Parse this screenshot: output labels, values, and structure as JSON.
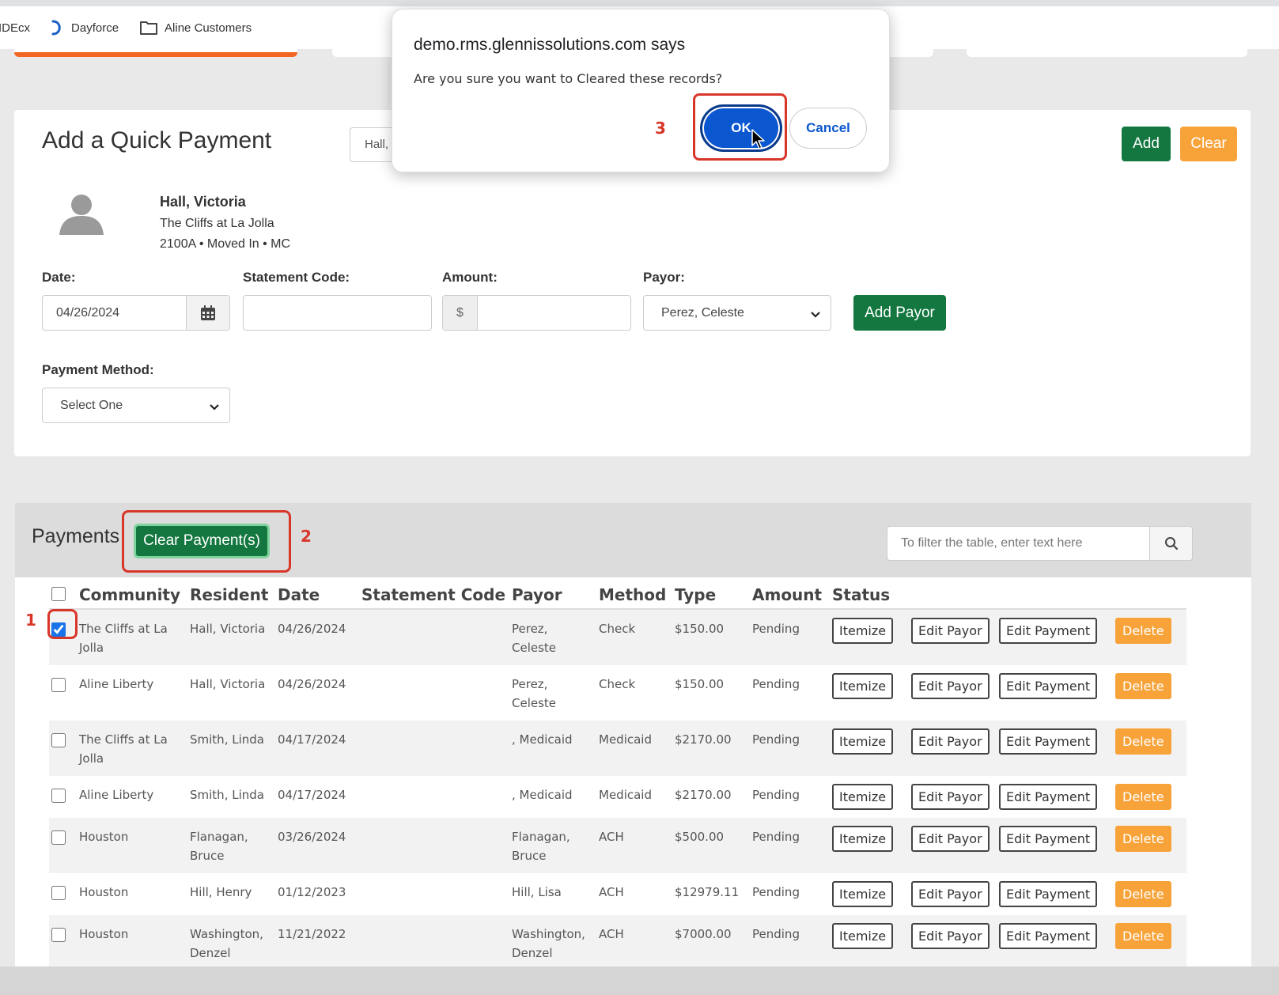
{
  "bookmarks": [
    {
      "label": "IDEcx",
      "icon": "idecx-icon"
    },
    {
      "label": "Dayforce",
      "icon": "dayforce-icon"
    },
    {
      "label": "Aline Customers",
      "icon": "folder-icon"
    }
  ],
  "dialog": {
    "title": "demo.rms.glennissolutions.com says",
    "message": "Are you sure you want to Cleared these records?",
    "ok_label": "OK",
    "cancel_label": "Cancel"
  },
  "quick_payment": {
    "title": "Add a Quick Payment",
    "resident_search_value": "Hall,",
    "add_label": "Add",
    "clear_label": "Clear",
    "resident": {
      "name": "Hall, Victoria",
      "community": "The Cliffs at La Jolla",
      "unit_status": "2100A • Moved In • MC"
    },
    "date_label": "Date:",
    "date_value": "04/26/2024",
    "statement_code_label": "Statement Code:",
    "statement_code_value": "",
    "amount_label": "Amount:",
    "amount_prefix": "$",
    "amount_value": "",
    "payor_label": "Payor:",
    "payor_value": "Perez, Celeste",
    "add_payor_label": "Add Payor",
    "payment_method_label": "Payment Method:",
    "payment_method_value": "Select One"
  },
  "payments": {
    "title": "Payments",
    "clear_payments_label": "Clear Payment(s)",
    "filter_placeholder": "To filter the table, enter text here",
    "columns": [
      "Community",
      "Resident",
      "Date",
      "Statement Code",
      "Payor",
      "Method",
      "Type",
      "Amount",
      "Status"
    ],
    "action_labels": {
      "itemize": "Itemize",
      "edit_payor": "Edit Payor",
      "edit_payment": "Edit Payment",
      "delete": "Delete"
    },
    "rows": [
      {
        "checked": true,
        "community": "The Cliffs at La Jolla",
        "resident": "Hall, Victoria",
        "date": "04/26/2024",
        "statement_code": "",
        "payor": "Perez, Celeste",
        "method": "Check",
        "amount": "$150.00",
        "status": "Pending"
      },
      {
        "checked": false,
        "community": "Aline Liberty",
        "resident": "Hall, Victoria",
        "date": "04/26/2024",
        "statement_code": "",
        "payor": "Perez, Celeste",
        "method": "Check",
        "amount": "$150.00",
        "status": "Pending"
      },
      {
        "checked": false,
        "community": "The Cliffs at La Jolla",
        "resident": "Smith, Linda",
        "date": "04/17/2024",
        "statement_code": "",
        "payor": ", Medicaid",
        "method": "Medicaid",
        "amount": "$2170.00",
        "status": "Pending"
      },
      {
        "checked": false,
        "community": "Aline Liberty",
        "resident": "Smith, Linda",
        "date": "04/17/2024",
        "statement_code": "",
        "payor": ", Medicaid",
        "method": "Medicaid",
        "amount": "$2170.00",
        "status": "Pending"
      },
      {
        "checked": false,
        "community": "Houston",
        "resident": "Flanagan, Bruce",
        "date": "03/26/2024",
        "statement_code": "",
        "payor": "Flanagan, Bruce",
        "method": "ACH",
        "amount": "$500.00",
        "status": "Pending"
      },
      {
        "checked": false,
        "community": "Houston",
        "resident": "Hill, Henry",
        "date": "01/12/2023",
        "statement_code": "",
        "payor": "Hill, Lisa",
        "method": "ACH",
        "amount": "$12979.11",
        "status": "Pending"
      },
      {
        "checked": false,
        "community": "Houston",
        "resident": "Washington, Denzel",
        "date": "11/21/2022",
        "statement_code": "",
        "payor": "Washington, Denzel",
        "method": "ACH",
        "amount": "$7000.00",
        "status": "Pending"
      }
    ]
  },
  "annotations": [
    "1",
    "2",
    "3"
  ],
  "colors": {
    "green": "#13773f",
    "orange": "#f7a33a",
    "dialog_blue": "#0b57d0",
    "annotation_red": "#d9362a"
  }
}
